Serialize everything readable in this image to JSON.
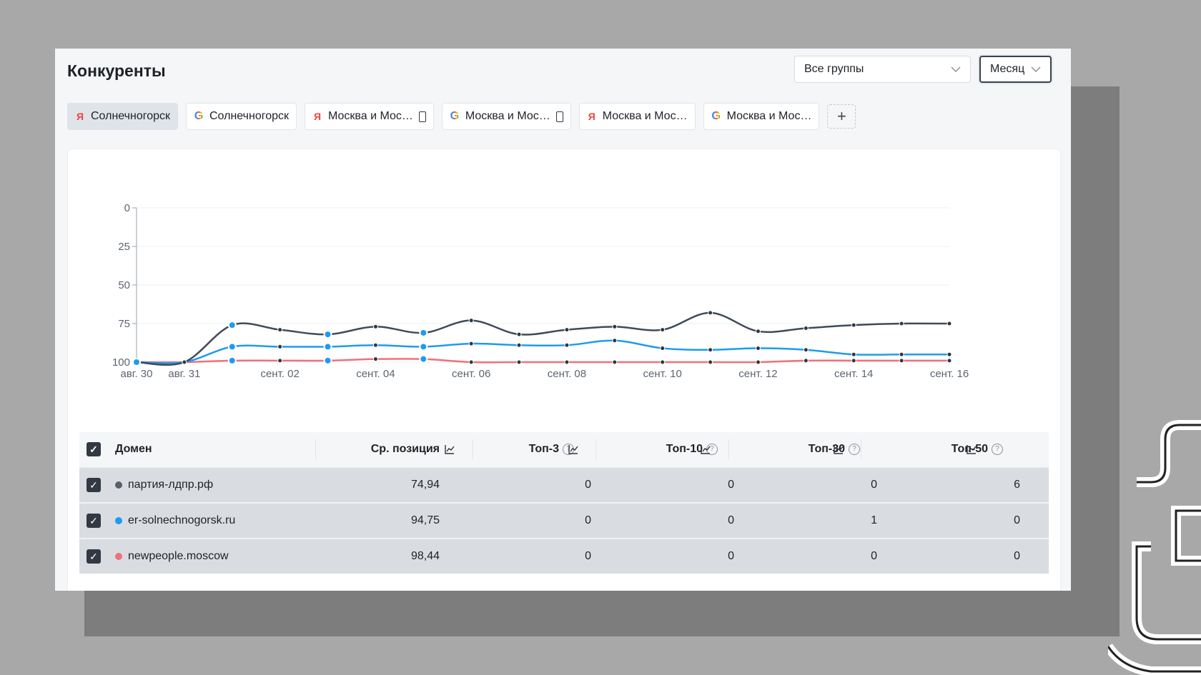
{
  "header": {
    "title": "Конкуренты"
  },
  "filters": {
    "groups": {
      "value": "Все группы",
      "icon": "chevron-down-icon"
    },
    "period": {
      "value": "Месяц",
      "icon": "chevron-down-icon"
    }
  },
  "tabs": [
    {
      "engine": "yandex",
      "engine_glyph": "Я",
      "label": "Солнечногорск",
      "mobile": false,
      "active": true
    },
    {
      "engine": "google",
      "engine_glyph": "G",
      "label": "Солнечногорск",
      "mobile": false,
      "active": false
    },
    {
      "engine": "yandex",
      "engine_glyph": "Я",
      "label": "Москва и Мос…",
      "mobile": true,
      "active": false
    },
    {
      "engine": "google",
      "engine_glyph": "G",
      "label": "Москва и Мос…",
      "mobile": true,
      "active": false
    },
    {
      "engine": "yandex",
      "engine_glyph": "Я",
      "label": "Москва и Мос…",
      "mobile": false,
      "active": false
    },
    {
      "engine": "google",
      "engine_glyph": "G",
      "label": "Москва и Мос…",
      "mobile": false,
      "active": false
    }
  ],
  "add_tab": {
    "label": "+"
  },
  "chart_data": {
    "type": "line",
    "x": [
      "авг. 30",
      "авг. 31",
      "сент. 01",
      "сент. 02",
      "сент. 03",
      "сент. 04",
      "сент. 05",
      "сент. 06",
      "сент. 07",
      "сент. 08",
      "сент. 09",
      "сент. 10",
      "сент. 11",
      "сент. 12",
      "сент. 13",
      "сент. 14",
      "сент. 15",
      "сент. 16"
    ],
    "x_tick_labels": [
      "авг. 30",
      "авг. 31",
      "сент. 02",
      "сент. 04",
      "сент. 06",
      "сент. 08",
      "сент. 10",
      "сент. 12",
      "сент. 14",
      "сент. 16"
    ],
    "y_ticks": [
      0,
      25,
      50,
      75,
      100
    ],
    "ylim": [
      0,
      100
    ],
    "y_inverted": true,
    "grid": true,
    "series": [
      {
        "name": "партия-лдпр.рф",
        "color": "#3f4b5a",
        "values": [
          100,
          100,
          76,
          79,
          82,
          77,
          81,
          73,
          82,
          79,
          77,
          79,
          68,
          80,
          78,
          76,
          75,
          75
        ]
      },
      {
        "name": "er-solnechnogorsk.ru",
        "color": "#1e9bf0",
        "values": [
          100,
          100,
          90,
          90,
          90,
          89,
          90,
          88,
          89,
          89,
          86,
          91,
          92,
          91,
          92,
          95,
          95,
          95
        ]
      },
      {
        "name": "newpeople.moscow",
        "color": "#f07178",
        "values": [
          100,
          100,
          99,
          99,
          99,
          98,
          98,
          100,
          100,
          100,
          100,
          100,
          100,
          100,
          99,
          99,
          99,
          99
        ]
      }
    ]
  },
  "table": {
    "header": {
      "domain": "Домен",
      "avg": "Ср. позиция",
      "top3": "Топ-3",
      "top10": "Топ-10",
      "top30": "Топ-30",
      "top50": "Топ-50",
      "help": "?"
    },
    "rows": [
      {
        "domain": "партия-лдпр.рф",
        "color": "#5b6068",
        "avg": "74,94",
        "top3": "0",
        "top10": "0",
        "top30": "0",
        "top50": "6"
      },
      {
        "domain": "er-solnechnogorsk.ru",
        "color": "#1e9bf0",
        "avg": "94,75",
        "top3": "0",
        "top10": "0",
        "top30": "1",
        "top50": "0"
      },
      {
        "domain": "newpeople.moscow",
        "color": "#f07178",
        "avg": "98,44",
        "top3": "0",
        "top10": "0",
        "top30": "0",
        "top50": "0"
      }
    ]
  }
}
